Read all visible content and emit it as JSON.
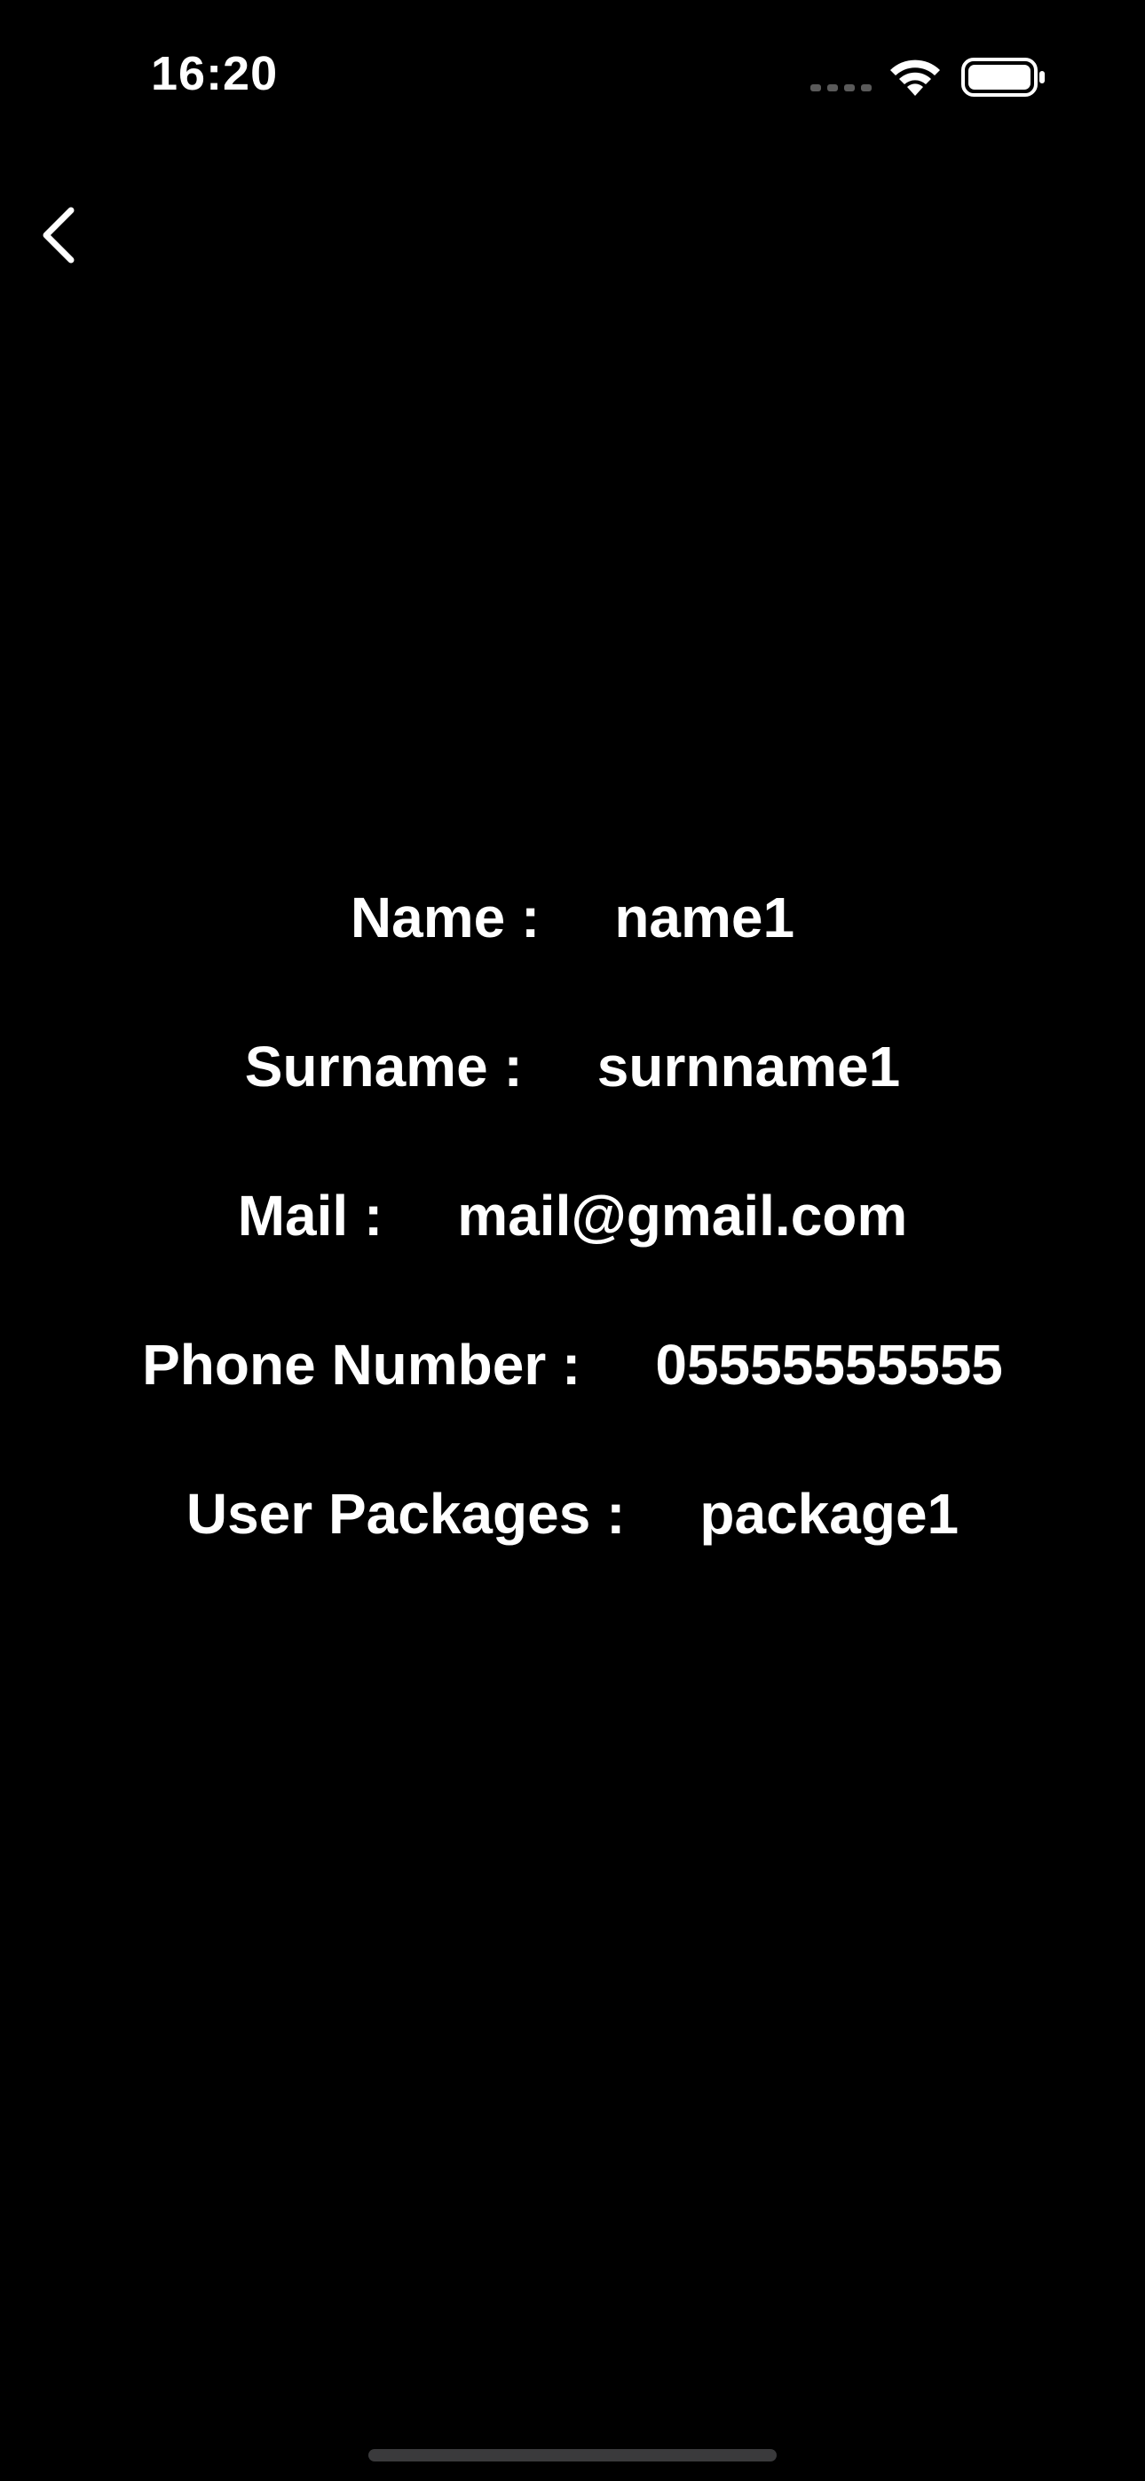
{
  "status_bar": {
    "time": "16:20",
    "icons": [
      "cellular-signal-icon",
      "wifi-icon",
      "battery-icon"
    ]
  },
  "nav": {
    "back_icon": "chevron-left-icon"
  },
  "user_info": {
    "name": {
      "label": "Name :",
      "value": "name1"
    },
    "surname": {
      "label": "Surname :",
      "value": "surnname1"
    },
    "mail": {
      "label": "Mail :",
      "value": "mail@gmail.com"
    },
    "phone": {
      "label": "Phone Number :",
      "value": "05555555555"
    },
    "packages": {
      "label": "User Packages :",
      "value": "package1"
    }
  },
  "colors": {
    "background": "#000000",
    "text": "#ffffff",
    "home_indicator": "#3a3a3c"
  }
}
